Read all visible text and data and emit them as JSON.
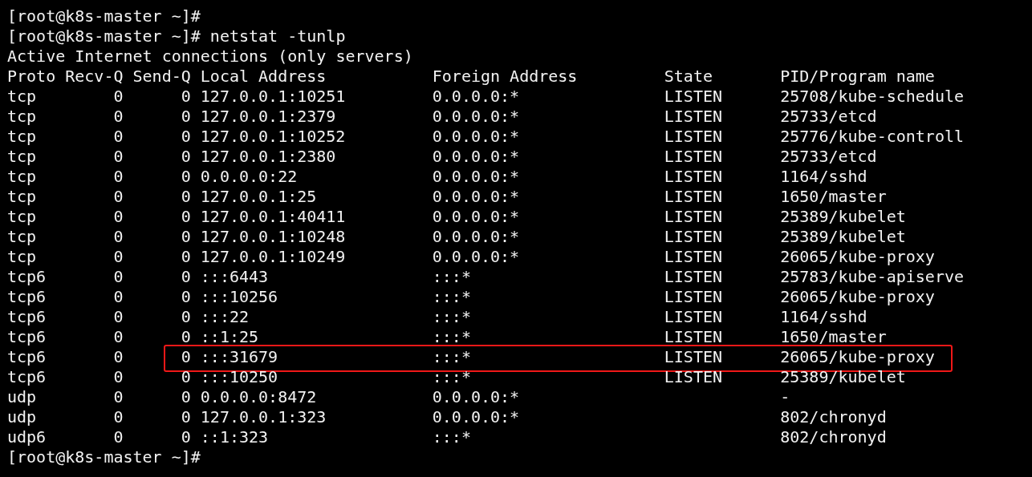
{
  "lines_before": [
    "[root@k8s-master ~]#",
    "[root@k8s-master ~]# netstat -tunlp"
  ],
  "output_title": "Active Internet connections (only servers)",
  "table": {
    "columns": [
      "Proto",
      "Recv-Q",
      "Send-Q",
      "Local Address",
      "Foreign Address",
      "State",
      "PID/Program name"
    ],
    "rows": [
      {
        "proto": "tcp",
        "recv_q": "0",
        "send_q": "0",
        "local_address": "127.0.0.1:10251",
        "foreign_address": "0.0.0.0:*",
        "state": "LISTEN",
        "pid_program": "25708/kube-schedule",
        "highlighted": false
      },
      {
        "proto": "tcp",
        "recv_q": "0",
        "send_q": "0",
        "local_address": "127.0.0.1:2379",
        "foreign_address": "0.0.0.0:*",
        "state": "LISTEN",
        "pid_program": "25733/etcd",
        "highlighted": false
      },
      {
        "proto": "tcp",
        "recv_q": "0",
        "send_q": "0",
        "local_address": "127.0.0.1:10252",
        "foreign_address": "0.0.0.0:*",
        "state": "LISTEN",
        "pid_program": "25776/kube-controll",
        "highlighted": false
      },
      {
        "proto": "tcp",
        "recv_q": "0",
        "send_q": "0",
        "local_address": "127.0.0.1:2380",
        "foreign_address": "0.0.0.0:*",
        "state": "LISTEN",
        "pid_program": "25733/etcd",
        "highlighted": false
      },
      {
        "proto": "tcp",
        "recv_q": "0",
        "send_q": "0",
        "local_address": "0.0.0.0:22",
        "foreign_address": "0.0.0.0:*",
        "state": "LISTEN",
        "pid_program": "1164/sshd",
        "highlighted": false
      },
      {
        "proto": "tcp",
        "recv_q": "0",
        "send_q": "0",
        "local_address": "127.0.0.1:25",
        "foreign_address": "0.0.0.0:*",
        "state": "LISTEN",
        "pid_program": "1650/master",
        "highlighted": false
      },
      {
        "proto": "tcp",
        "recv_q": "0",
        "send_q": "0",
        "local_address": "127.0.0.1:40411",
        "foreign_address": "0.0.0.0:*",
        "state": "LISTEN",
        "pid_program": "25389/kubelet",
        "highlighted": false
      },
      {
        "proto": "tcp",
        "recv_q": "0",
        "send_q": "0",
        "local_address": "127.0.0.1:10248",
        "foreign_address": "0.0.0.0:*",
        "state": "LISTEN",
        "pid_program": "25389/kubelet",
        "highlighted": false
      },
      {
        "proto": "tcp",
        "recv_q": "0",
        "send_q": "0",
        "local_address": "127.0.0.1:10249",
        "foreign_address": "0.0.0.0:*",
        "state": "LISTEN",
        "pid_program": "26065/kube-proxy",
        "highlighted": false
      },
      {
        "proto": "tcp6",
        "recv_q": "0",
        "send_q": "0",
        "local_address": ":::6443",
        "foreign_address": ":::*",
        "state": "LISTEN",
        "pid_program": "25783/kube-apiserve",
        "highlighted": false
      },
      {
        "proto": "tcp6",
        "recv_q": "0",
        "send_q": "0",
        "local_address": ":::10256",
        "foreign_address": ":::*",
        "state": "LISTEN",
        "pid_program": "26065/kube-proxy",
        "highlighted": false
      },
      {
        "proto": "tcp6",
        "recv_q": "0",
        "send_q": "0",
        "local_address": ":::22",
        "foreign_address": ":::*",
        "state": "LISTEN",
        "pid_program": "1164/sshd",
        "highlighted": false
      },
      {
        "proto": "tcp6",
        "recv_q": "0",
        "send_q": "0",
        "local_address": "::1:25",
        "foreign_address": ":::*",
        "state": "LISTEN",
        "pid_program": "1650/master",
        "highlighted": false
      },
      {
        "proto": "tcp6",
        "recv_q": "0",
        "send_q": "0",
        "local_address": ":::31679",
        "foreign_address": ":::*",
        "state": "LISTEN",
        "pid_program": "26065/kube-proxy",
        "highlighted": true
      },
      {
        "proto": "tcp6",
        "recv_q": "0",
        "send_q": "0",
        "local_address": ":::10250",
        "foreign_address": ":::*",
        "state": "LISTEN",
        "pid_program": "25389/kubelet",
        "highlighted": false
      },
      {
        "proto": "udp",
        "recv_q": "0",
        "send_q": "0",
        "local_address": "0.0.0.0:8472",
        "foreign_address": "0.0.0.0:*",
        "pid_program": "-",
        "highlighted": false
      },
      {
        "proto": "udp",
        "recv_q": "0",
        "send_q": "0",
        "local_address": "127.0.0.1:323",
        "foreign_address": "0.0.0.0:*",
        "pid_program": "802/chronyd",
        "highlighted": false
      },
      {
        "proto": "udp6",
        "recv_q": "0",
        "send_q": "0",
        "local_address": "::1:323",
        "foreign_address": ":::*",
        "pid_program": "802/chronyd",
        "highlighted": false
      }
    ]
  },
  "lines_after": [
    "[root@k8s-master ~]#"
  ]
}
